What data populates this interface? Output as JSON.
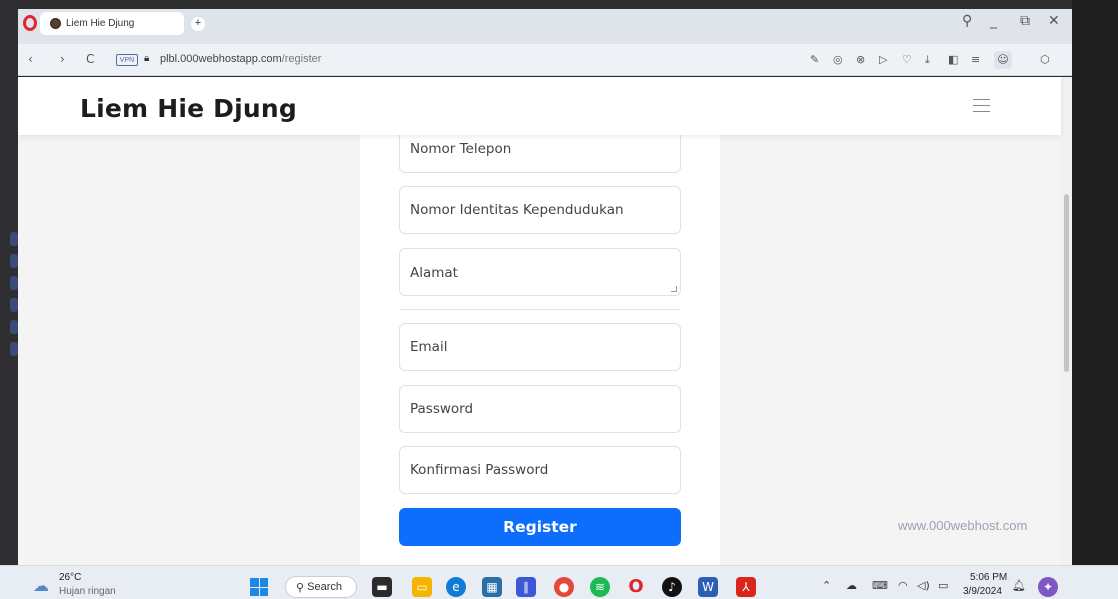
{
  "browser": {
    "tab_title": "Liem Hie Djung",
    "new_tab": "+",
    "url_host": "plbl.000webhostapp.com",
    "url_path": "/register",
    "vpn_label": "VPN",
    "back": "‹",
    "forward": "›",
    "reload": "C",
    "minimize": "_",
    "restore": "⧉",
    "close": "✕",
    "search_icon": "⚲"
  },
  "navbar": {
    "brand": "Liem Hie Djung"
  },
  "form": {
    "fields": [
      {
        "placeholder": "Nomor Telepon"
      },
      {
        "placeholder": "Nomor Identitas Kependudukan"
      },
      {
        "placeholder": "Alamat"
      },
      {
        "placeholder": "Email"
      },
      {
        "placeholder": "Password"
      },
      {
        "placeholder": "Konfirmasi Password"
      }
    ],
    "register_label": "Register"
  },
  "footer": {
    "host_link": "www.000webhost.com"
  },
  "taskbar": {
    "weather_temp": "26°C",
    "weather_desc": "Hujan ringan",
    "search_label": "Search",
    "time": "5:06 PM",
    "date": "3/9/2024",
    "accent_color": "#0d6efd"
  }
}
